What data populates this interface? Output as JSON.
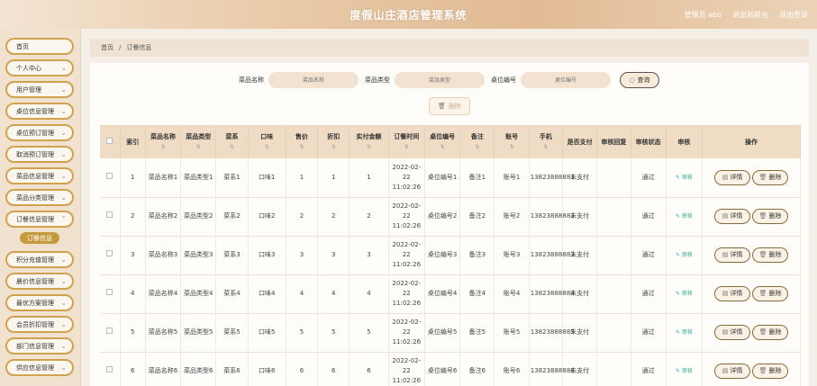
{
  "header": {
    "title": "度假山庄酒店管理系统",
    "links": [
      "管理员 abo",
      "退出到前台",
      "退出登录"
    ]
  },
  "sidebar": {
    "items": [
      "首页",
      "个人中心",
      "用户管理",
      "桌位信息管理",
      "桌位预订管理",
      "取消预订管理",
      "菜品信息管理",
      "菜品分类管理",
      "订餐信息管理",
      "积分充值管理",
      "晨价信息管理",
      "最优方案管理",
      "会员折扣管理",
      "部门信息管理",
      "供应信息管理"
    ],
    "active_sub": "订餐信息"
  },
  "breadcrumb": {
    "home": "首页",
    "sep": "/",
    "current": "订餐信息"
  },
  "search": {
    "fields": [
      {
        "label": "菜品名称",
        "placeholder": "菜品名称"
      },
      {
        "label": "菜品类型",
        "placeholder": "菜品类型"
      },
      {
        "label": "桌位编号",
        "placeholder": "桌位编号"
      }
    ],
    "search_label": "查询",
    "delete_label": "删除"
  },
  "table": {
    "headers": [
      "",
      "索引",
      "菜品名称",
      "菜品类型",
      "菜系",
      "口味",
      "售价",
      "折扣",
      "实付金额",
      "订餐时间",
      "桌位编号",
      "备注",
      "账号",
      "手机",
      "是否支付",
      "审核回复",
      "审核状态",
      "审核",
      "操作"
    ],
    "sortable": [
      false,
      false,
      true,
      true,
      true,
      true,
      true,
      true,
      true,
      true,
      true,
      true,
      true,
      true,
      false,
      false,
      false,
      false,
      false
    ],
    "sort_symbol": "⇅",
    "rows": [
      [
        "1",
        "菜品名称1",
        "菜品类型1",
        "菜系1",
        "口味1",
        "1",
        "1",
        "1",
        "2022-02-22 11:02:26",
        "桌位编号1",
        "备注1",
        "账号1",
        "13823888881",
        "未支付",
        "",
        "通过",
        "审核"
      ],
      [
        "2",
        "菜品名称2",
        "菜品类型2",
        "菜系2",
        "口味2",
        "2",
        "2",
        "2",
        "2022-02-22 11:02:26",
        "桌位编号2",
        "备注2",
        "账号2",
        "13823888882",
        "未支付",
        "",
        "通过",
        "审核"
      ],
      [
        "3",
        "菜品名称3",
        "菜品类型3",
        "菜系3",
        "口味3",
        "3",
        "3",
        "3",
        "2022-02-22 11:02:26",
        "桌位编号3",
        "备注3",
        "账号3",
        "13823888883",
        "未支付",
        "",
        "通过",
        "审核"
      ],
      [
        "4",
        "菜品名称4",
        "菜品类型4",
        "菜系4",
        "口味4",
        "4",
        "4",
        "4",
        "2022-02-22 11:02:26",
        "桌位编号4",
        "备注4",
        "账号4",
        "13823888884",
        "未支付",
        "",
        "通过",
        "审核"
      ],
      [
        "5",
        "菜品名称5",
        "菜品类型5",
        "菜系5",
        "口味5",
        "5",
        "5",
        "5",
        "2022-02-22 11:02:26",
        "桌位编号5",
        "备注5",
        "账号5",
        "13823888885",
        "未支付",
        "",
        "通过",
        "审核"
      ],
      [
        "6",
        "菜品名称6",
        "菜品类型6",
        "菜系6",
        "口味6",
        "6",
        "6",
        "6",
        "2022-02-22 11:02:26",
        "桌位编号6",
        "备注6",
        "账号6",
        "13823888886",
        "未支付",
        "",
        "通过",
        "审核"
      ]
    ],
    "detail_label": "详情",
    "row_delete_label": "删除"
  },
  "colors": {
    "accent": "#d0a24d",
    "header": "#e2bb95",
    "audit": "#2eaa9a"
  }
}
